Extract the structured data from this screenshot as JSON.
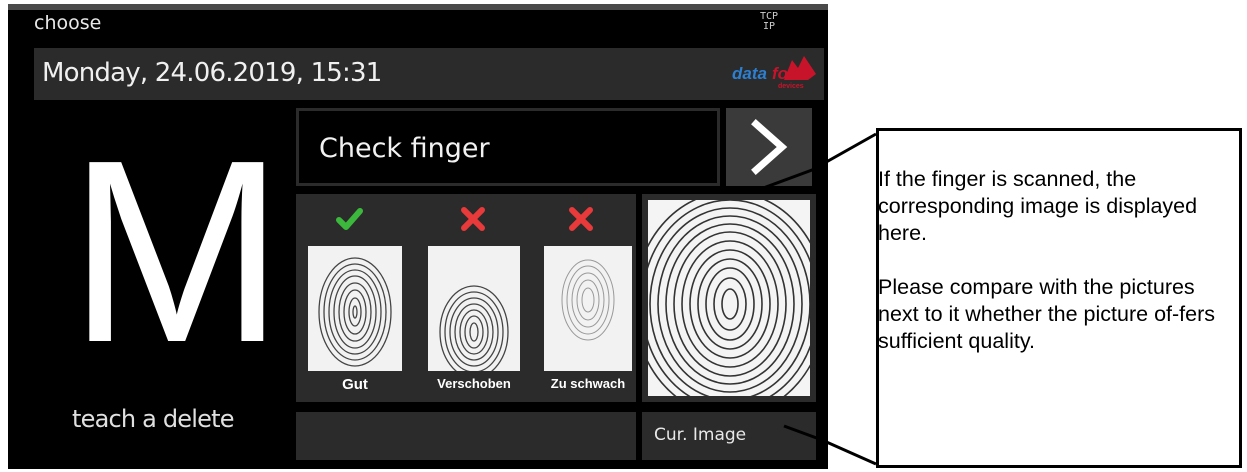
{
  "header": {
    "mode_label": "choose",
    "connection_top": "TCP",
    "connection_bottom": "IP",
    "datetime": "Monday, 24.06.2019, 15:31"
  },
  "logo": {
    "part1": "data",
    "part2": "fox",
    "sub": "devices"
  },
  "left": {
    "big_letter": "M",
    "caption": "teach a delete"
  },
  "main": {
    "title": "Check finger",
    "next_icon": "chevron-right-icon"
  },
  "examples": [
    {
      "label": "Gut",
      "status": "good",
      "icon": "checkmark-icon"
    },
    {
      "label": "Verschoben",
      "status": "bad",
      "icon": "cross-icon"
    },
    {
      "label": "Zu schwach",
      "status": "bad",
      "icon": "cross-icon"
    }
  ],
  "current": {
    "label": "Cur. Image"
  },
  "callout": {
    "para1": "If the finger is scanned, the corresponding image is displayed here.",
    "para2": "Please compare with the pictures next to it whether the picture of-fers sufficient quality."
  },
  "colors": {
    "good": "#3cb93c",
    "bad": "#e83a3a",
    "logo_blue": "#2d7fd0",
    "logo_red": "#c8142a"
  }
}
